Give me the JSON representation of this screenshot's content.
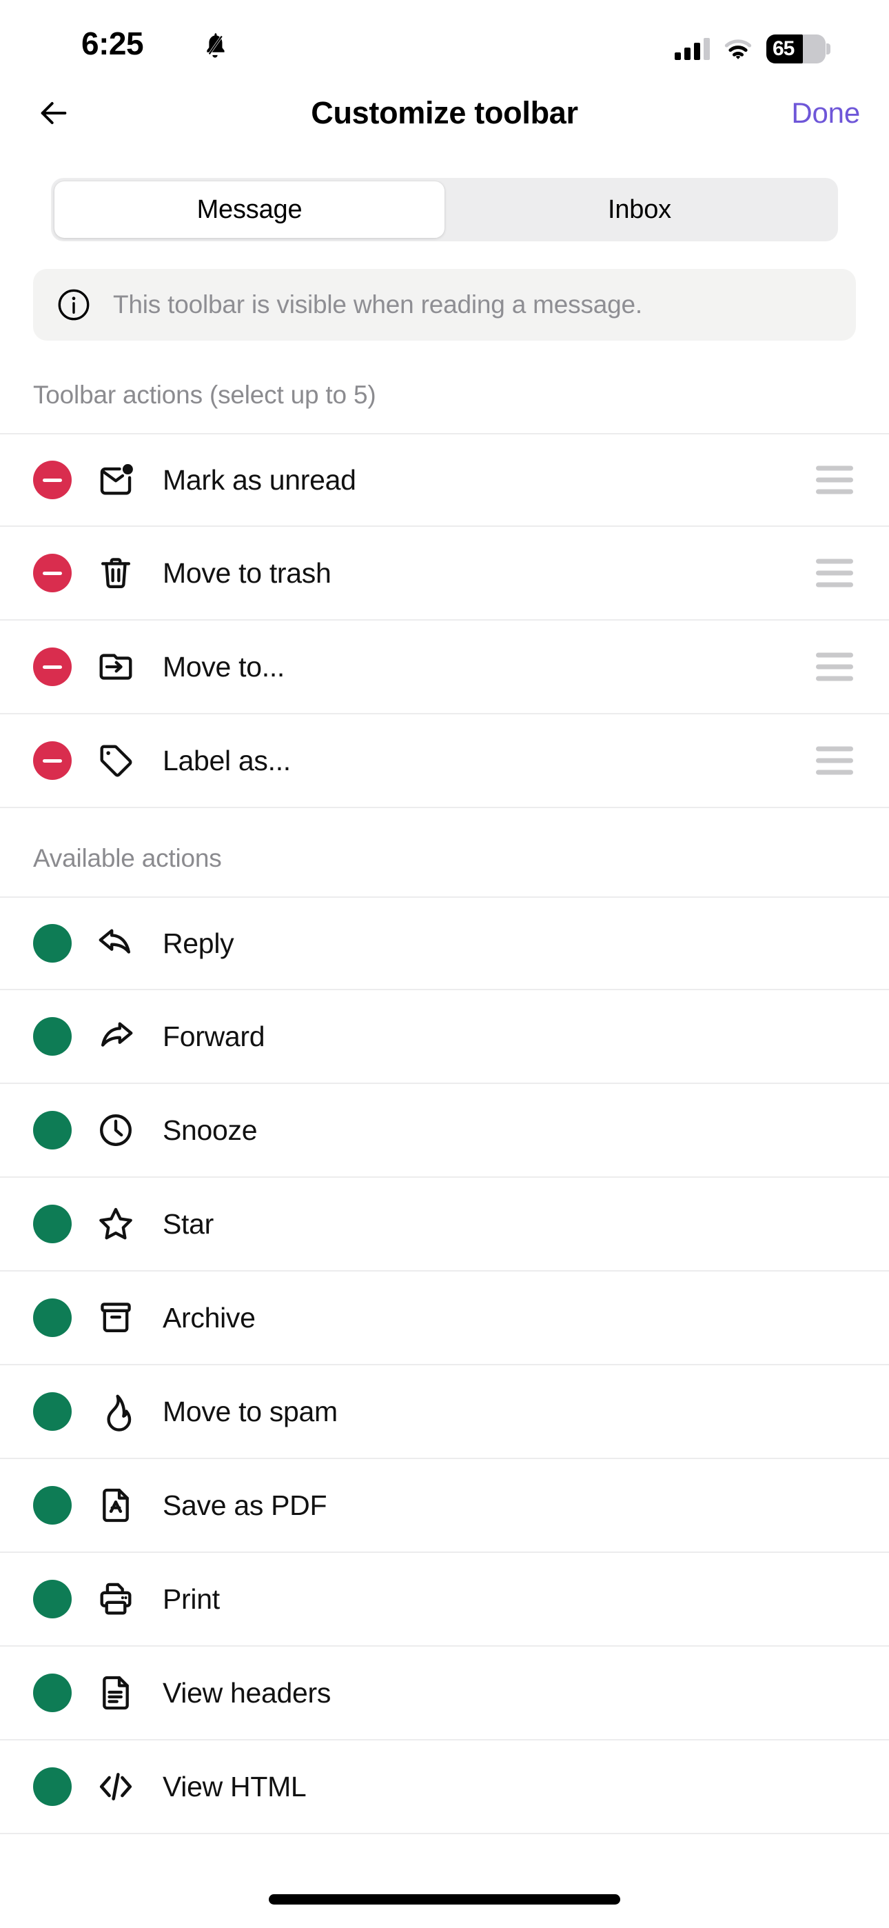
{
  "status_bar": {
    "time": "6:25",
    "silent_icon": "bell-slash-icon",
    "signal_icon": "cellular-signal-icon",
    "wifi_icon": "wifi-icon",
    "battery_percent": "65",
    "battery_icon": "battery-icon"
  },
  "nav": {
    "back_icon": "back-arrow-icon",
    "title": "Customize toolbar",
    "done_label": "Done"
  },
  "segmented": {
    "options": [
      {
        "label": "Message",
        "selected": true
      },
      {
        "label": "Inbox",
        "selected": false
      }
    ]
  },
  "banner": {
    "icon": "info-circle-icon",
    "text": "This toolbar is visible when reading a message."
  },
  "toolbar_section": {
    "header": "Toolbar actions (select up to 5)",
    "items": [
      {
        "label": "Mark as unread",
        "icon": "envelope-dot-icon",
        "badge": "minus-icon",
        "handle": "drag-handle-icon"
      },
      {
        "label": "Move to trash",
        "icon": "trash-icon",
        "badge": "minus-icon",
        "handle": "drag-handle-icon"
      },
      {
        "label": "Move to...",
        "icon": "folder-arrow-icon",
        "badge": "minus-icon",
        "handle": "drag-handle-icon"
      },
      {
        "label": "Label as...",
        "icon": "tag-icon",
        "badge": "minus-icon",
        "handle": "drag-handle-icon"
      }
    ]
  },
  "available_section": {
    "header": "Available actions",
    "items": [
      {
        "label": "Reply",
        "icon": "reply-arrow-icon",
        "badge": "plus-icon"
      },
      {
        "label": "Forward",
        "icon": "forward-arrow-icon",
        "badge": "plus-icon"
      },
      {
        "label": "Snooze",
        "icon": "clock-icon",
        "badge": "plus-icon"
      },
      {
        "label": "Star",
        "icon": "star-icon",
        "badge": "plus-icon"
      },
      {
        "label": "Archive",
        "icon": "archive-box-icon",
        "badge": "plus-icon"
      },
      {
        "label": "Move to spam",
        "icon": "flame-icon",
        "badge": "plus-icon"
      },
      {
        "label": "Save as PDF",
        "icon": "pdf-document-icon",
        "badge": "plus-icon"
      },
      {
        "label": "Print",
        "icon": "printer-icon",
        "badge": "plus-icon"
      },
      {
        "label": "View headers",
        "icon": "document-lines-icon",
        "badge": "plus-icon"
      },
      {
        "label": "View HTML",
        "icon": "code-brackets-icon",
        "badge": "plus-icon"
      }
    ]
  },
  "colors": {
    "accent_purple": "#6E56D8",
    "remove_red": "#D92D4E",
    "add_green": "#0E7C55",
    "muted_gray": "#8e8e93"
  },
  "home_indicator": "home-indicator"
}
